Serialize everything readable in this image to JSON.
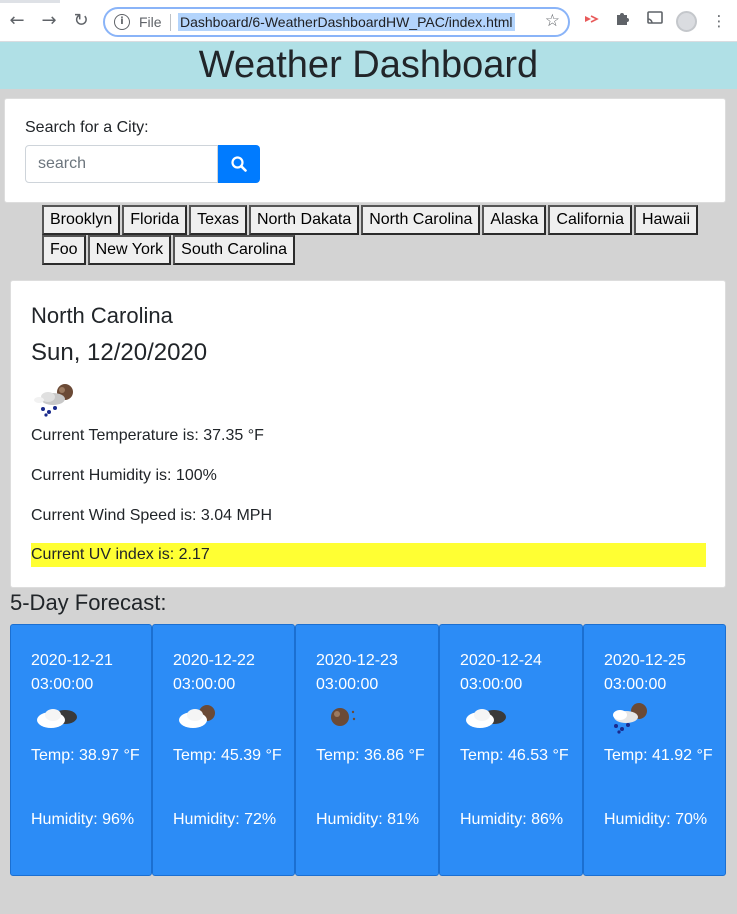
{
  "browser": {
    "back": "←",
    "forward": "→",
    "reload": "↻",
    "info_icon": "i",
    "scheme_label": "File",
    "url": "Dashboard/6-WeatherDashboardHW_PAC/index.html",
    "star": "☆"
  },
  "header": {
    "title": "Weather Dashboard"
  },
  "search": {
    "label": "Search for a City:",
    "placeholder": "search",
    "button_color": "#007bff"
  },
  "cities": [
    "Brooklyn",
    "Florida",
    "Texas",
    "North Dakata",
    "North Carolina",
    "Alaska",
    "California",
    "Hawaii",
    "Foo",
    "New York",
    "South Carolina"
  ],
  "current": {
    "city": "North Carolina",
    "date": "Sun, 12/20/2020",
    "icon": "rain-cloud-icon",
    "temperature": "Current Temperature is: 37.35 °F",
    "humidity": "Current Humidity is: 100%",
    "wind": "Current Wind Speed is: 3.04 MPH",
    "uv": "Current UV index is: 2.17",
    "uv_color": "#ffff33"
  },
  "forecast": {
    "title": "5-Day Forecast:",
    "card_color": "#2c8cf6",
    "days": [
      {
        "date": "2020-12-21",
        "time": "03:00:00",
        "icon": "cloudy-icon",
        "temp": "Temp: 38.97 °F",
        "humidity": "Humidity: 96%"
      },
      {
        "date": "2020-12-22",
        "time": "03:00:00",
        "icon": "partly-cloudy-icon",
        "temp": "Temp: 45.39 °F",
        "humidity": "Humidity: 72%"
      },
      {
        "date": "2020-12-23",
        "time": "03:00:00",
        "icon": "clear-night-icon",
        "temp": "Temp: 36.86 °F",
        "humidity": "Humidity: 81%"
      },
      {
        "date": "2020-12-24",
        "time": "03:00:00",
        "icon": "cloudy-icon",
        "temp": "Temp: 46.53 °F",
        "humidity": "Humidity: 86%"
      },
      {
        "date": "2020-12-25",
        "time": "03:00:00",
        "icon": "rain-cloud-icon",
        "temp": "Temp: 41.92 °F",
        "humidity": "Humidity: 70%"
      }
    ]
  }
}
